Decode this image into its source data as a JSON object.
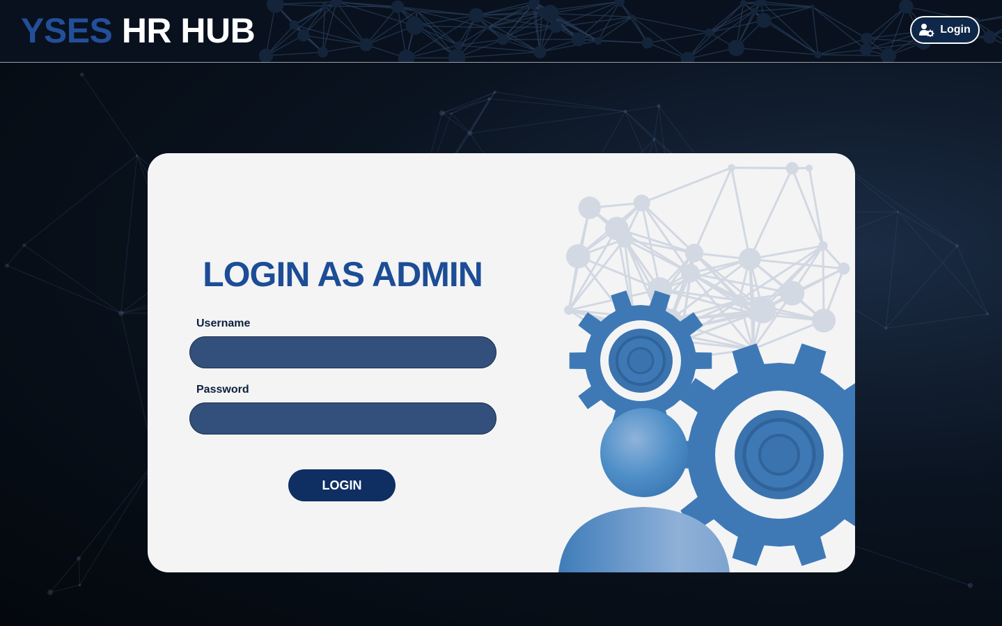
{
  "brand": {
    "part1": "YSES",
    "part2": "HR HUB"
  },
  "nav": {
    "login_label": "Login",
    "login_icon": "user-gear-icon"
  },
  "form": {
    "title": "LOGIN AS ADMIN",
    "username_label": "Username",
    "username_value": "",
    "password_label": "Password",
    "password_value": "",
    "submit_label": "LOGIN"
  },
  "colors": {
    "brand_blue": "#234f9a",
    "title_blue": "#1c4d96",
    "field_fill": "#33507c",
    "button_navy": "#0f2f63",
    "gear_blue": "#3e79b6"
  }
}
